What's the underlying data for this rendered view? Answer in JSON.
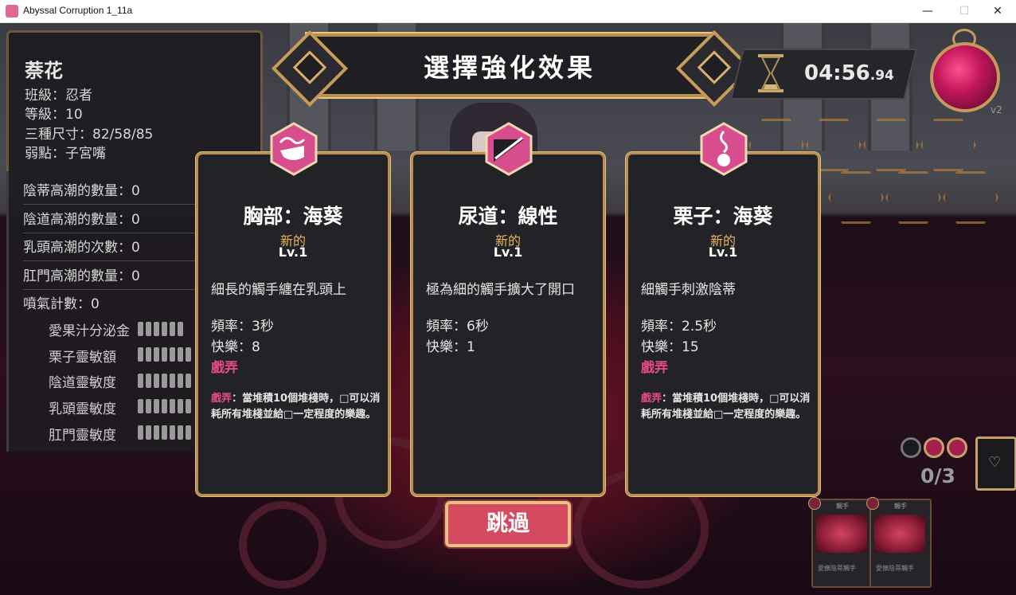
{
  "window": {
    "title": "Abyssal Corruption 1_11a",
    "minimize": "—",
    "maximize": "☐",
    "close": "✕"
  },
  "character": {
    "name": "萘花",
    "lines": [
      "班級：忍者",
      "等級：10",
      "三種尺寸：82/58/85",
      "弱點：子宮嘴"
    ],
    "counts": [
      "陰蒂高潮的數量：0",
      "陰道高潮的數量：0",
      "乳頭高潮的次數：0",
      "肛門高潮的數量：0",
      "噴氣計數：0"
    ],
    "sensitivity": [
      "愛果汁分泌金",
      "栗子靈敏額",
      "陰道靈敏度",
      "乳頭靈敏度",
      "肛門靈敏度"
    ]
  },
  "header": {
    "title": "選擇強化效果"
  },
  "timer": {
    "main": "04:56",
    "fraction": ".94"
  },
  "orb": {
    "label": "v2"
  },
  "cards": [
    {
      "title": "胸部：海葵",
      "new_label": "新的",
      "level": "Lv.1",
      "description": "細長的觸手纏在乳頭上",
      "frequency": "頻率：3秒",
      "pleasure": "快樂：8",
      "tag": "戲弄",
      "note_tag": "戲弄",
      "note": "：當堆積10個堆棧時，□可以消耗所有堆棧並給□一定程度的樂趣。",
      "icon": "breast-tentacle-icon"
    },
    {
      "title": "尿道：線性",
      "new_label": "新的",
      "level": "Lv.1",
      "description": "極為細的觸手擴大了開口",
      "frequency": "頻率：6秒",
      "pleasure": "快樂：1",
      "tag": "",
      "note_tag": "",
      "note": "",
      "icon": "urethra-line-icon"
    },
    {
      "title": "栗子：海葵",
      "new_label": "新的",
      "level": "Lv.1",
      "description": "細觸手刺激陰蒂",
      "frequency": "頻率：2.5秒",
      "pleasure": "快樂：15",
      "tag": "戲弄",
      "note_tag": "戲弄",
      "note": "：當堆積10個堆棧時，□可以消耗所有堆棧並給□一定程度的樂趣。",
      "icon": "clitoris-tentacle-icon"
    }
  ],
  "skip": {
    "label": "跳過"
  },
  "deck": {
    "counter": "0/3"
  },
  "hand": [
    {
      "title": "觸手",
      "desc": "愛撫陰蒂觸手"
    },
    {
      "title": "觸手",
      "desc": "愛撫陰蒂觸手"
    }
  ],
  "colors": {
    "gold": "#b98e4e",
    "accent_pink": "#e24b86",
    "skip_red": "#d44a61",
    "panel": "#232226"
  }
}
